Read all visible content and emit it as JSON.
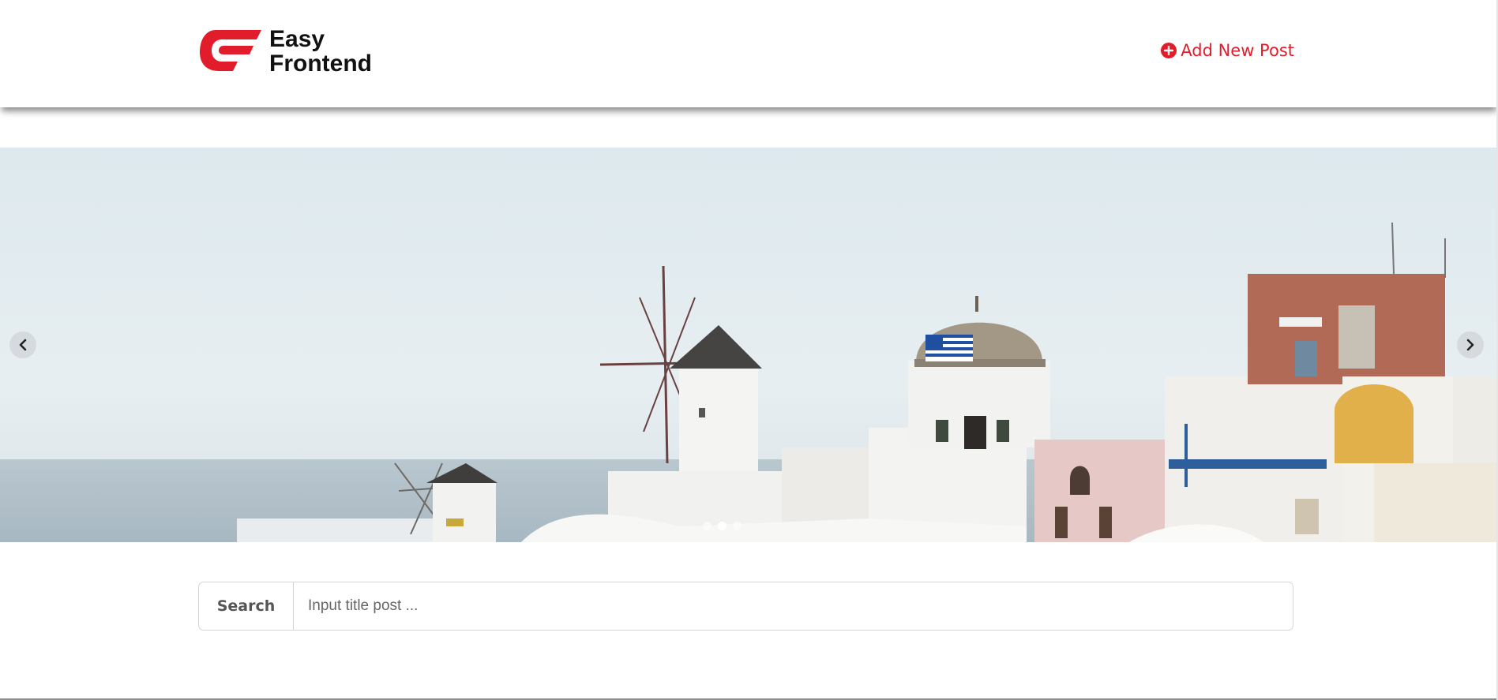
{
  "header": {
    "logo_line1": "Easy",
    "logo_line2": "Frontend",
    "add_post_label": "Add New Post"
  },
  "carousel": {
    "slide_image": "santorini-windmills-photo",
    "prev_icon": "chevron-left-icon",
    "next_icon": "chevron-right-icon",
    "slide_count": 3,
    "active_slide": 2
  },
  "search": {
    "label": "Search",
    "placeholder": "Input title post ...",
    "value": ""
  },
  "colors": {
    "brand": "#e11d2b",
    "text": "#111111",
    "border": "#d5d5d5"
  }
}
